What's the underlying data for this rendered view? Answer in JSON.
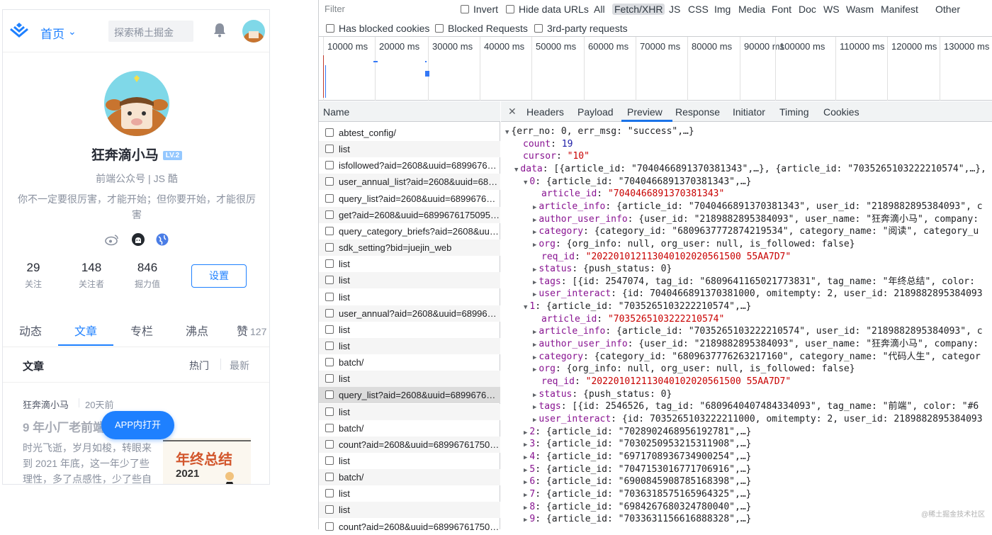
{
  "mobile": {
    "nav": {
      "home_label": "首页",
      "search_placeholder": "探索稀土掘金"
    },
    "profile": {
      "name": "狂奔滴小马",
      "level": "LV.2",
      "job": "前端公众号 | JS 酷",
      "bio": "你不一定要很厉害，才能开始；但你要开始，才能很厉害",
      "stats": [
        {
          "value": "29",
          "label": "关注"
        },
        {
          "value": "148",
          "label": "关注者"
        },
        {
          "value": "846",
          "label": "掘力值"
        }
      ],
      "settings_label": "设置"
    },
    "tabs": [
      {
        "label": "动态"
      },
      {
        "label": "文章"
      },
      {
        "label": "专栏"
      },
      {
        "label": "沸点"
      },
      {
        "label": "赞",
        "count": "127"
      }
    ],
    "list_header": {
      "title": "文章",
      "hot": "热门",
      "newest": "最新"
    },
    "article": {
      "author": "狂奔滴小马",
      "time": "20天前",
      "title": "9 年小厂老前端年终总结",
      "body": "时光飞逝，岁月如梭，转眼来到 2021 年底，这一年少了些理性，多了点感性，少了些自",
      "cover_title": "年终总结",
      "cover_year": "2021"
    },
    "app_button": "APP内打开"
  },
  "devtools": {
    "filter_placeholder": "Filter",
    "invert": "Invert",
    "hide_data_urls": "Hide data URLs",
    "types": [
      "All",
      "Fetch/XHR",
      "JS",
      "CSS",
      "Img",
      "Media",
      "Font",
      "Doc",
      "WS",
      "Wasm",
      "Manifest",
      "Other"
    ],
    "selected_type": "Fetch/XHR",
    "has_blocked_cookies": "Has blocked cookies",
    "blocked_requests": "Blocked Requests",
    "third_party": "3rd-party requests",
    "ticks": [
      "10000 ms",
      "20000 ms",
      "30000 ms",
      "40000 ms",
      "50000 ms",
      "60000 ms",
      "70000 ms",
      "80000 ms",
      "90000 ms",
      "100000 ms",
      "110000 ms",
      "120000 ms",
      "130000 ms"
    ],
    "name_header": "Name",
    "requests": [
      "abtest_config/",
      "list",
      "isfollowed?aid=2608&uuid=6899676175095...",
      "user_annual_list?aid=2608&uuid=6899676...",
      "query_list?aid=2608&uuid=68996761750...",
      "get?aid=2608&uuid=68996761750951790...",
      "query_category_briefs?aid=2608&uuid=...",
      "sdk_setting?bid=juejin_web",
      "list",
      "list",
      "list",
      "user_annual?aid=2608&uuid=68996761750...",
      "list",
      "list",
      "batch/",
      "list",
      "query_list?aid=2608&uuid=68996761750...",
      "list",
      "batch/",
      "count?aid=2608&uuid=689967617509517...",
      "list",
      "batch/",
      "list",
      "list",
      "count?aid=2608&uuid=689967617509517..."
    ],
    "selected_request_index": 16,
    "detail_tabs": [
      "Headers",
      "Payload",
      "Preview",
      "Response",
      "Initiator",
      "Timing",
      "Cookies"
    ],
    "active_detail_tab": "Preview",
    "json_lines": [
      {
        "indent": 0,
        "arrow": "▼",
        "parts": [
          [
            "w",
            "{err_no: 0, err_msg: \"success\",…}"
          ]
        ]
      },
      {
        "indent": 1,
        "arrow": "",
        "parts": [
          [
            "k",
            "count"
          ],
          [
            "w",
            ": "
          ],
          [
            "n",
            "19"
          ]
        ]
      },
      {
        "indent": 1,
        "arrow": "",
        "parts": [
          [
            "k",
            "cursor"
          ],
          [
            "w",
            ": "
          ],
          [
            "s",
            "\"10\""
          ]
        ]
      },
      {
        "indent": 1,
        "arrow": "▼",
        "parts": [
          [
            "k",
            "data"
          ],
          [
            "w",
            ": [{article_id: \"7040466891370381343\",…}, {article_id: \"7035265103222210574\",…},"
          ]
        ]
      },
      {
        "indent": 2,
        "arrow": "▼",
        "parts": [
          [
            "k",
            "0"
          ],
          [
            "w",
            ": {article_id: \"7040466891370381343\",…}"
          ]
        ]
      },
      {
        "indent": 3,
        "arrow": "",
        "parts": [
          [
            "k",
            "article_id"
          ],
          [
            "w",
            ": "
          ],
          [
            "s",
            "\"7040466891370381343\""
          ]
        ]
      },
      {
        "indent": 3,
        "arrow": "▶",
        "parts": [
          [
            "k",
            "article_info"
          ],
          [
            "w",
            ": {article_id: \"7040466891370381343\", user_id: \"2189882895384093\", c"
          ]
        ]
      },
      {
        "indent": 3,
        "arrow": "▶",
        "parts": [
          [
            "k",
            "author_user_info"
          ],
          [
            "w",
            ": {user_id: \"2189882895384093\", user_name: \"狂奔滴小马\", company:"
          ]
        ]
      },
      {
        "indent": 3,
        "arrow": "▶",
        "parts": [
          [
            "k",
            "category"
          ],
          [
            "w",
            ": {category_id: \"6809637772874219534\", category_name: \"阅读\", category_u"
          ]
        ]
      },
      {
        "indent": 3,
        "arrow": "▶",
        "parts": [
          [
            "k",
            "org"
          ],
          [
            "w",
            ": {org_info: null, org_user: null, is_followed: false}"
          ]
        ]
      },
      {
        "indent": 3,
        "arrow": "",
        "parts": [
          [
            "k",
            "req_id"
          ],
          [
            "w",
            ": "
          ],
          [
            "s",
            "\"202201012113040102020561500 55AA7D7\""
          ]
        ]
      },
      {
        "indent": 3,
        "arrow": "▶",
        "parts": [
          [
            "k",
            "status"
          ],
          [
            "w",
            ": {push_status: 0}"
          ]
        ]
      },
      {
        "indent": 3,
        "arrow": "▶",
        "parts": [
          [
            "k",
            "tags"
          ],
          [
            "w",
            ": [{id: 2547074, tag_id: \"6809641165021773831\", tag_name: \"年终总结\", color:"
          ]
        ]
      },
      {
        "indent": 3,
        "arrow": "▶",
        "parts": [
          [
            "k",
            "user_interact"
          ],
          [
            "w",
            ": {id: 7040466891370381000, omitempty: 2, user_id: 2189882895384093"
          ]
        ]
      },
      {
        "indent": 2,
        "arrow": "▼",
        "parts": [
          [
            "k",
            "1"
          ],
          [
            "w",
            ": {article_id: \"7035265103222210574\",…}"
          ]
        ]
      },
      {
        "indent": 3,
        "arrow": "",
        "parts": [
          [
            "k",
            "article_id"
          ],
          [
            "w",
            ": "
          ],
          [
            "s",
            "\"7035265103222210574\""
          ]
        ]
      },
      {
        "indent": 3,
        "arrow": "▶",
        "parts": [
          [
            "k",
            "article_info"
          ],
          [
            "w",
            ": {article_id: \"7035265103222210574\", user_id: \"2189882895384093\", c"
          ]
        ]
      },
      {
        "indent": 3,
        "arrow": "▶",
        "parts": [
          [
            "k",
            "author_user_info"
          ],
          [
            "w",
            ": {user_id: \"2189882895384093\", user_name: \"狂奔滴小马\", company:"
          ]
        ]
      },
      {
        "indent": 3,
        "arrow": "▶",
        "parts": [
          [
            "k",
            "category"
          ],
          [
            "w",
            ": {category_id: \"6809637776263217160\", category_name: \"代码人生\", categor"
          ]
        ]
      },
      {
        "indent": 3,
        "arrow": "▶",
        "parts": [
          [
            "k",
            "org"
          ],
          [
            "w",
            ": {org_info: null, org_user: null, is_followed: false}"
          ]
        ]
      },
      {
        "indent": 3,
        "arrow": "",
        "parts": [
          [
            "k",
            "req_id"
          ],
          [
            "w",
            ": "
          ],
          [
            "s",
            "\"202201012113040102020561500 55AA7D7\""
          ]
        ]
      },
      {
        "indent": 3,
        "arrow": "▶",
        "parts": [
          [
            "k",
            "status"
          ],
          [
            "w",
            ": {push_status: 0}"
          ]
        ]
      },
      {
        "indent": 3,
        "arrow": "▶",
        "parts": [
          [
            "k",
            "tags"
          ],
          [
            "w",
            ": [{id: 2546526, tag_id: \"6809640407484334093\", tag_name: \"前端\", color: \"#6"
          ]
        ]
      },
      {
        "indent": 3,
        "arrow": "▶",
        "parts": [
          [
            "k",
            "user_interact"
          ],
          [
            "w",
            ": {id: 7035265103222211000, omitempty: 2, user_id: 2189882895384093"
          ]
        ]
      },
      {
        "indent": 2,
        "arrow": "▶",
        "parts": [
          [
            "k",
            "2"
          ],
          [
            "w",
            ": {article_id: \"7028902468956192781\",…}"
          ]
        ]
      },
      {
        "indent": 2,
        "arrow": "▶",
        "parts": [
          [
            "k",
            "3"
          ],
          [
            "w",
            ": {article_id: \"7030250953215311908\",…}"
          ]
        ]
      },
      {
        "indent": 2,
        "arrow": "▶",
        "parts": [
          [
            "k",
            "4"
          ],
          [
            "w",
            ": {article_id: \"6971708936734900254\",…}"
          ]
        ]
      },
      {
        "indent": 2,
        "arrow": "▶",
        "parts": [
          [
            "k",
            "5"
          ],
          [
            "w",
            ": {article_id: \"7047153016771706916\",…}"
          ]
        ]
      },
      {
        "indent": 2,
        "arrow": "▶",
        "parts": [
          [
            "k",
            "6"
          ],
          [
            "w",
            ": {article_id: \"6900845908785168398\",…}"
          ]
        ]
      },
      {
        "indent": 2,
        "arrow": "▶",
        "parts": [
          [
            "k",
            "7"
          ],
          [
            "w",
            ": {article_id: \"7036318575165964325\",…}"
          ]
        ]
      },
      {
        "indent": 2,
        "arrow": "▶",
        "parts": [
          [
            "k",
            "8"
          ],
          [
            "w",
            ": {article_id: \"6984267680324780040\",…}"
          ]
        ]
      },
      {
        "indent": 2,
        "arrow": "▶",
        "parts": [
          [
            "k",
            "9"
          ],
          [
            "w",
            ": {article_id: \"7033631156616888328\",…}"
          ]
        ]
      }
    ]
  },
  "watermark": "@稀土掘金技术社区",
  "colors": {
    "brand": "#1e80ff",
    "json_key": "#881391",
    "json_string": "#c80000",
    "json_number": "#1a1aa6",
    "devtools_accent": "#1a73e8"
  }
}
